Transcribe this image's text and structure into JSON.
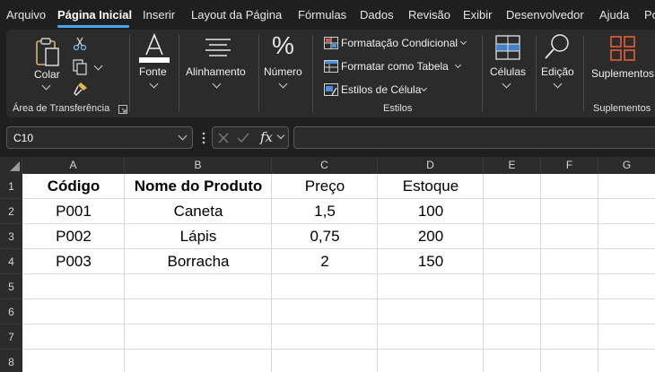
{
  "menu": {
    "tabs": [
      "Arquivo",
      "Página Inicial",
      "Inserir",
      "Layout da Página",
      "Fórmulas",
      "Dados",
      "Revisão",
      "Exibir",
      "Desenvolvedor",
      "Ajuda",
      "Po"
    ],
    "active": "Página Inicial"
  },
  "ribbon": {
    "clipboard": {
      "paste_label": "Colar",
      "group_label": "Área de Transferência"
    },
    "font": {
      "label": "Fonte"
    },
    "alignment": {
      "label": "Alinhamento"
    },
    "number": {
      "label": "Número"
    },
    "styles": {
      "conditional": "Formatação Condicional",
      "table": "Formatar como Tabela",
      "cell_styles": "Estilos de Célula",
      "group_label": "Estilos"
    },
    "cells": {
      "label": "Células"
    },
    "editing": {
      "label": "Edição"
    },
    "addins": {
      "label": "Suplementos",
      "group_label": "Suplementos"
    }
  },
  "formula_bar": {
    "name_box": "C10",
    "fx": "fx",
    "formula": ""
  },
  "grid": {
    "columns": [
      "A",
      "B",
      "C",
      "D",
      "E",
      "F",
      "G"
    ],
    "rows": [
      "1",
      "2",
      "3",
      "4",
      "5",
      "6",
      "7",
      "8"
    ],
    "cells": [
      [
        "Código",
        "Nome do Produto",
        "Preço",
        "Estoque"
      ],
      [
        "P001",
        "Caneta",
        "1,5",
        "100"
      ],
      [
        "P002",
        "Lápis",
        "0,75",
        "200"
      ],
      [
        "P003",
        "Borracha",
        "2",
        "150"
      ]
    ]
  },
  "colors": {
    "accent": "#4aa5f0",
    "ribbon_bg": "#2b2b2b",
    "app_bg": "#1f1f1f"
  }
}
